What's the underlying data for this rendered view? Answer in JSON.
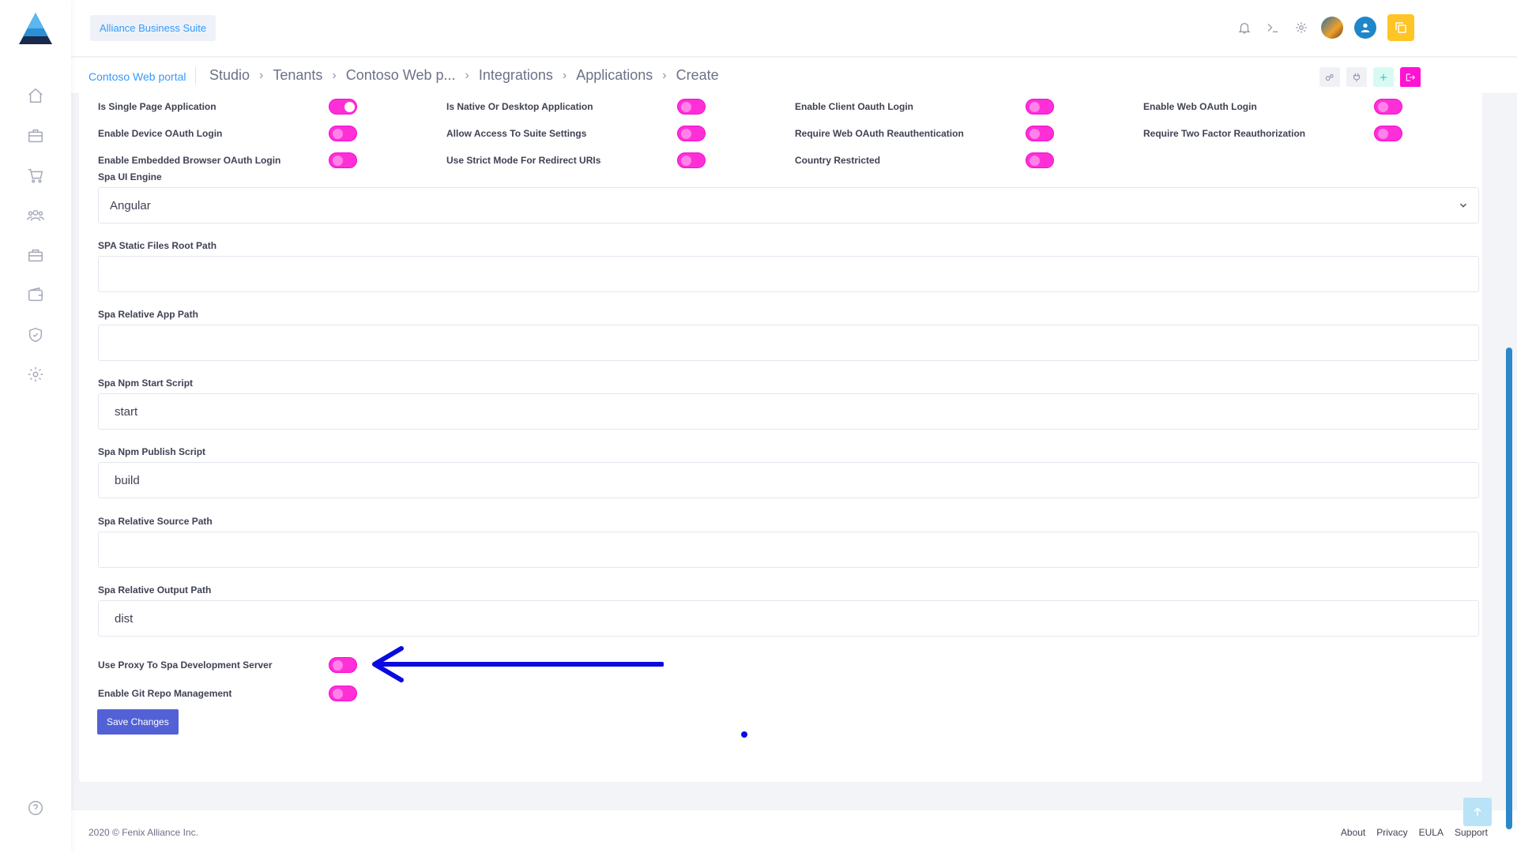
{
  "header": {
    "brand_label": "Alliance Business Suite",
    "icons": [
      "bell-icon",
      "terminal-icon",
      "gear-icon",
      "user-photo-avatar",
      "user-icon",
      "copy-icon"
    ]
  },
  "breadcrumb": {
    "root": "Contoso Web portal",
    "items": [
      "Studio",
      "Tenants",
      "Contoso Web p...",
      "Integrations",
      "Applications",
      "Create"
    ]
  },
  "sidebar": {
    "icons": [
      "home-icon",
      "briefcase-icon",
      "cart-icon",
      "users-icon",
      "toolbox-icon",
      "wallet-icon",
      "shield-icon",
      "settings-icon",
      "help-icon"
    ]
  },
  "toggles": [
    {
      "label": "Is Single Page Application",
      "on": true
    },
    {
      "label": "Is Native Or Desktop Application",
      "on": false
    },
    {
      "label": "Enable Client Oauth Login",
      "on": false
    },
    {
      "label": "Enable Web OAuth Login",
      "on": false
    },
    {
      "label": "Enable Device OAuth Login",
      "on": false
    },
    {
      "label": "Allow Access To Suite Settings",
      "on": false
    },
    {
      "label": "Require Web OAuth Reauthentication",
      "on": false
    },
    {
      "label": "Require Two Factor Reauthorization",
      "on": false
    },
    {
      "label": "Enable Embedded Browser OAuth Login",
      "on": false
    },
    {
      "label": "Use Strict Mode For Redirect URIs",
      "on": false
    },
    {
      "label": "Country Restricted",
      "on": false
    }
  ],
  "fields": {
    "spa_ui_engine": {
      "label": "Spa UI Engine",
      "value": "Angular"
    },
    "static_root": {
      "label": "SPA Static Files Root Path",
      "value": ""
    },
    "relative_app_path": {
      "label": "Spa Relative App Path",
      "value": ""
    },
    "npm_start": {
      "label": "Spa Npm Start Script",
      "value": "start"
    },
    "npm_publish": {
      "label": "Spa Npm Publish Script",
      "value": "build"
    },
    "relative_source": {
      "label": "Spa Relative Source Path",
      "value": ""
    },
    "relative_output": {
      "label": "Spa Relative Output Path",
      "value": "dist"
    }
  },
  "bottom_toggles": [
    {
      "label": "Use Proxy To Spa Development Server",
      "on": false
    },
    {
      "label": "Enable Git Repo Management",
      "on": false
    }
  ],
  "actions": {
    "save_label": "Save Changes"
  },
  "footer": {
    "copyright": "2020 © Fenix Alliance Inc.",
    "links": [
      "About",
      "Privacy",
      "EULA",
      "Support"
    ]
  },
  "colors": {
    "accent": "#3699ff",
    "toggle": "#ff2fd8",
    "save": "#5262d6",
    "annotation": "#0a0ae0"
  }
}
